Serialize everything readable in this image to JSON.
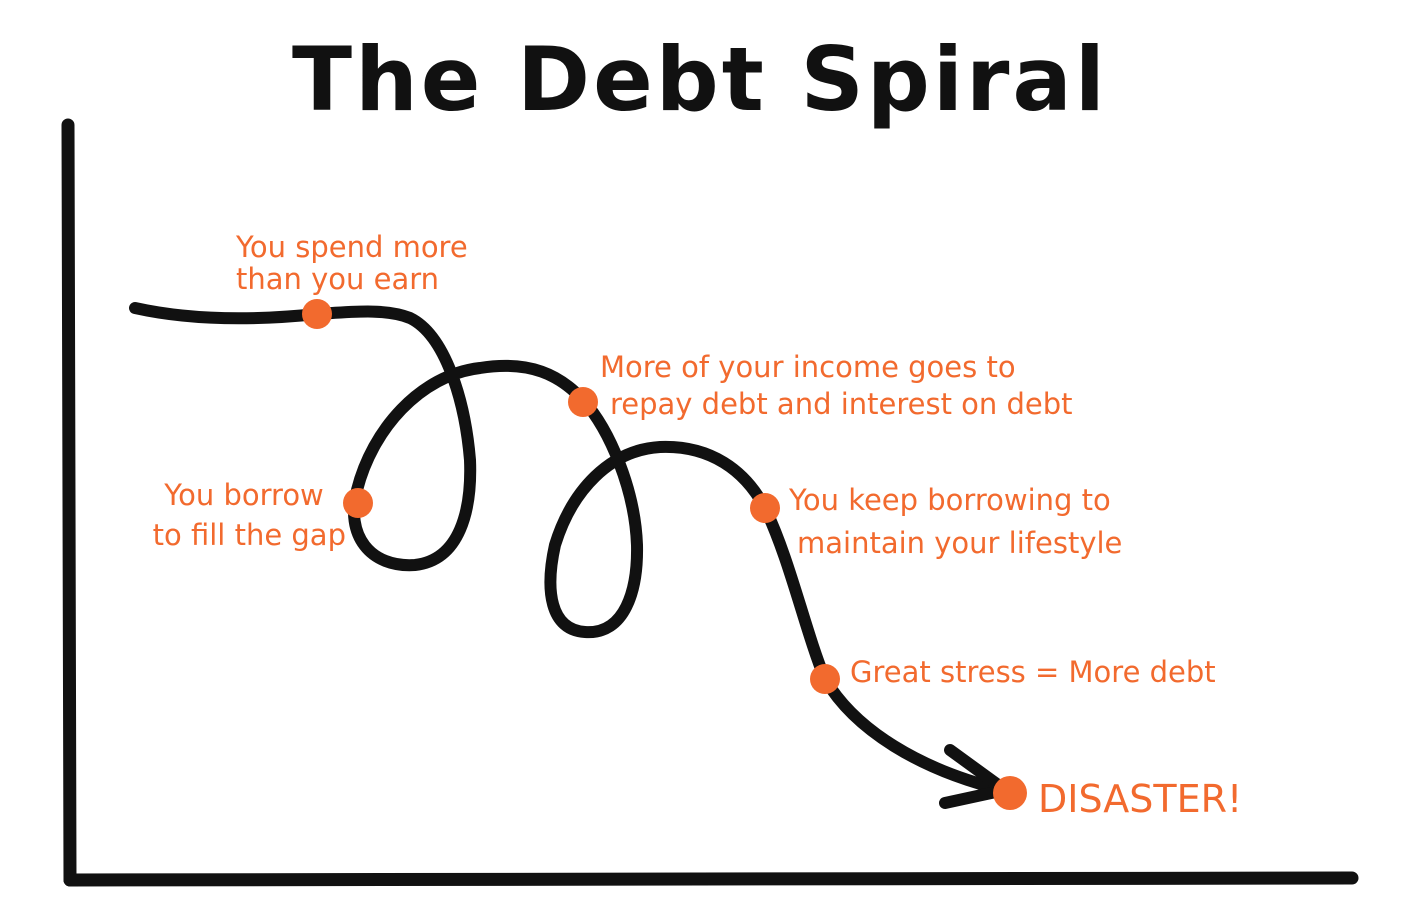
{
  "title": "The Debt Spiral",
  "colors": {
    "ink": "#111111",
    "accent": "#f26a2e",
    "background": "#ffffff"
  },
  "steps": [
    {
      "lines": [
        "You spend more",
        "than you earn"
      ]
    },
    {
      "lines": [
        "You borrow",
        "to fill the gap"
      ]
    },
    {
      "lines": [
        "More of your income goes to",
        "repay debt and interest on debt"
      ]
    },
    {
      "lines": [
        "You keep borrowing to",
        "maintain your lifestyle"
      ]
    },
    {
      "lines": [
        "Great stress = More debt"
      ]
    },
    {
      "lines": [
        "DISASTER!"
      ]
    }
  ]
}
